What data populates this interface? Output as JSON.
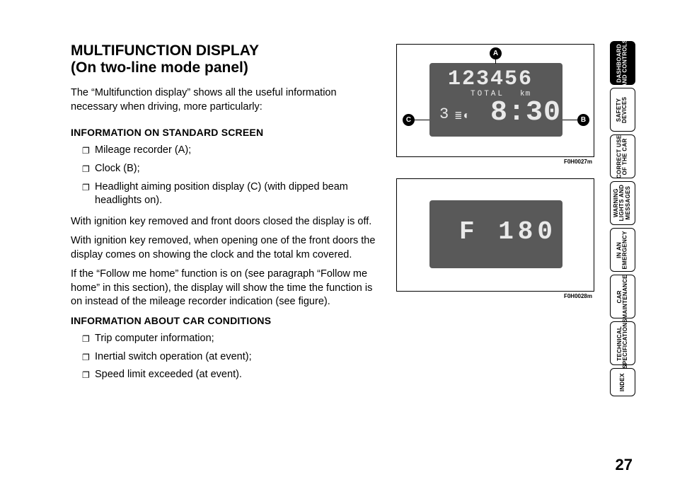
{
  "title_l1": "MULTIFUNCTION DISPLAY",
  "title_l2": "(On two-line mode panel)",
  "intro": "The “Multifunction display” shows all the useful information necessary when driving, more particularly:",
  "sec1_head": "INFORMATION ON STANDARD SCREEN",
  "sec1_items": {
    "i0": "Mileage recorder (A);",
    "i1": "Clock (B);",
    "i2": "Headlight aiming position display (C) (with dipped beam headlights on)."
  },
  "p1": "With ignition key removed and front doors closed the display is off.",
  "p2": "With ignition key removed, when opening one of the front doors the display comes on showing the clock and the total km covered.",
  "p3": "If the “Follow me home” function is on (see paragraph “Follow me home” in this section), the display will show the time the function is on instead of the mileage recorder indication (see figure).",
  "sec2_head": "INFORMATION ABOUT CAR CONDITIONS",
  "sec2_items": {
    "i0": "Trip computer information;",
    "i1": "Inertial switch operation (at event);",
    "i2": "Speed limit exceeded (at event)."
  },
  "fig1": {
    "odometer": "123456",
    "total": "TOTAL",
    "km": "km",
    "aim_digit": "3",
    "clock": "8:30",
    "caption": "F0H0027m",
    "callA": "A",
    "callB": "B",
    "callC": "C"
  },
  "fig2": {
    "text": "F 180",
    "caption": "F0H0028m"
  },
  "tabs": {
    "t0": "DASHBOARD\nAND CONTROLS",
    "t1": "SAFETY\nDEVICES",
    "t2": "CORRECT USE\nOF THE CAR",
    "t3": "WARNING\nLIGHTS AND\nMESSAGES",
    "t4": "IN AN\nEMERGENCY",
    "t5": "CAR\nMAINTENANCE",
    "t6": "TECHNICAL\nSPECIFICATIONS",
    "t7": "INDEX"
  },
  "page_number": "27"
}
